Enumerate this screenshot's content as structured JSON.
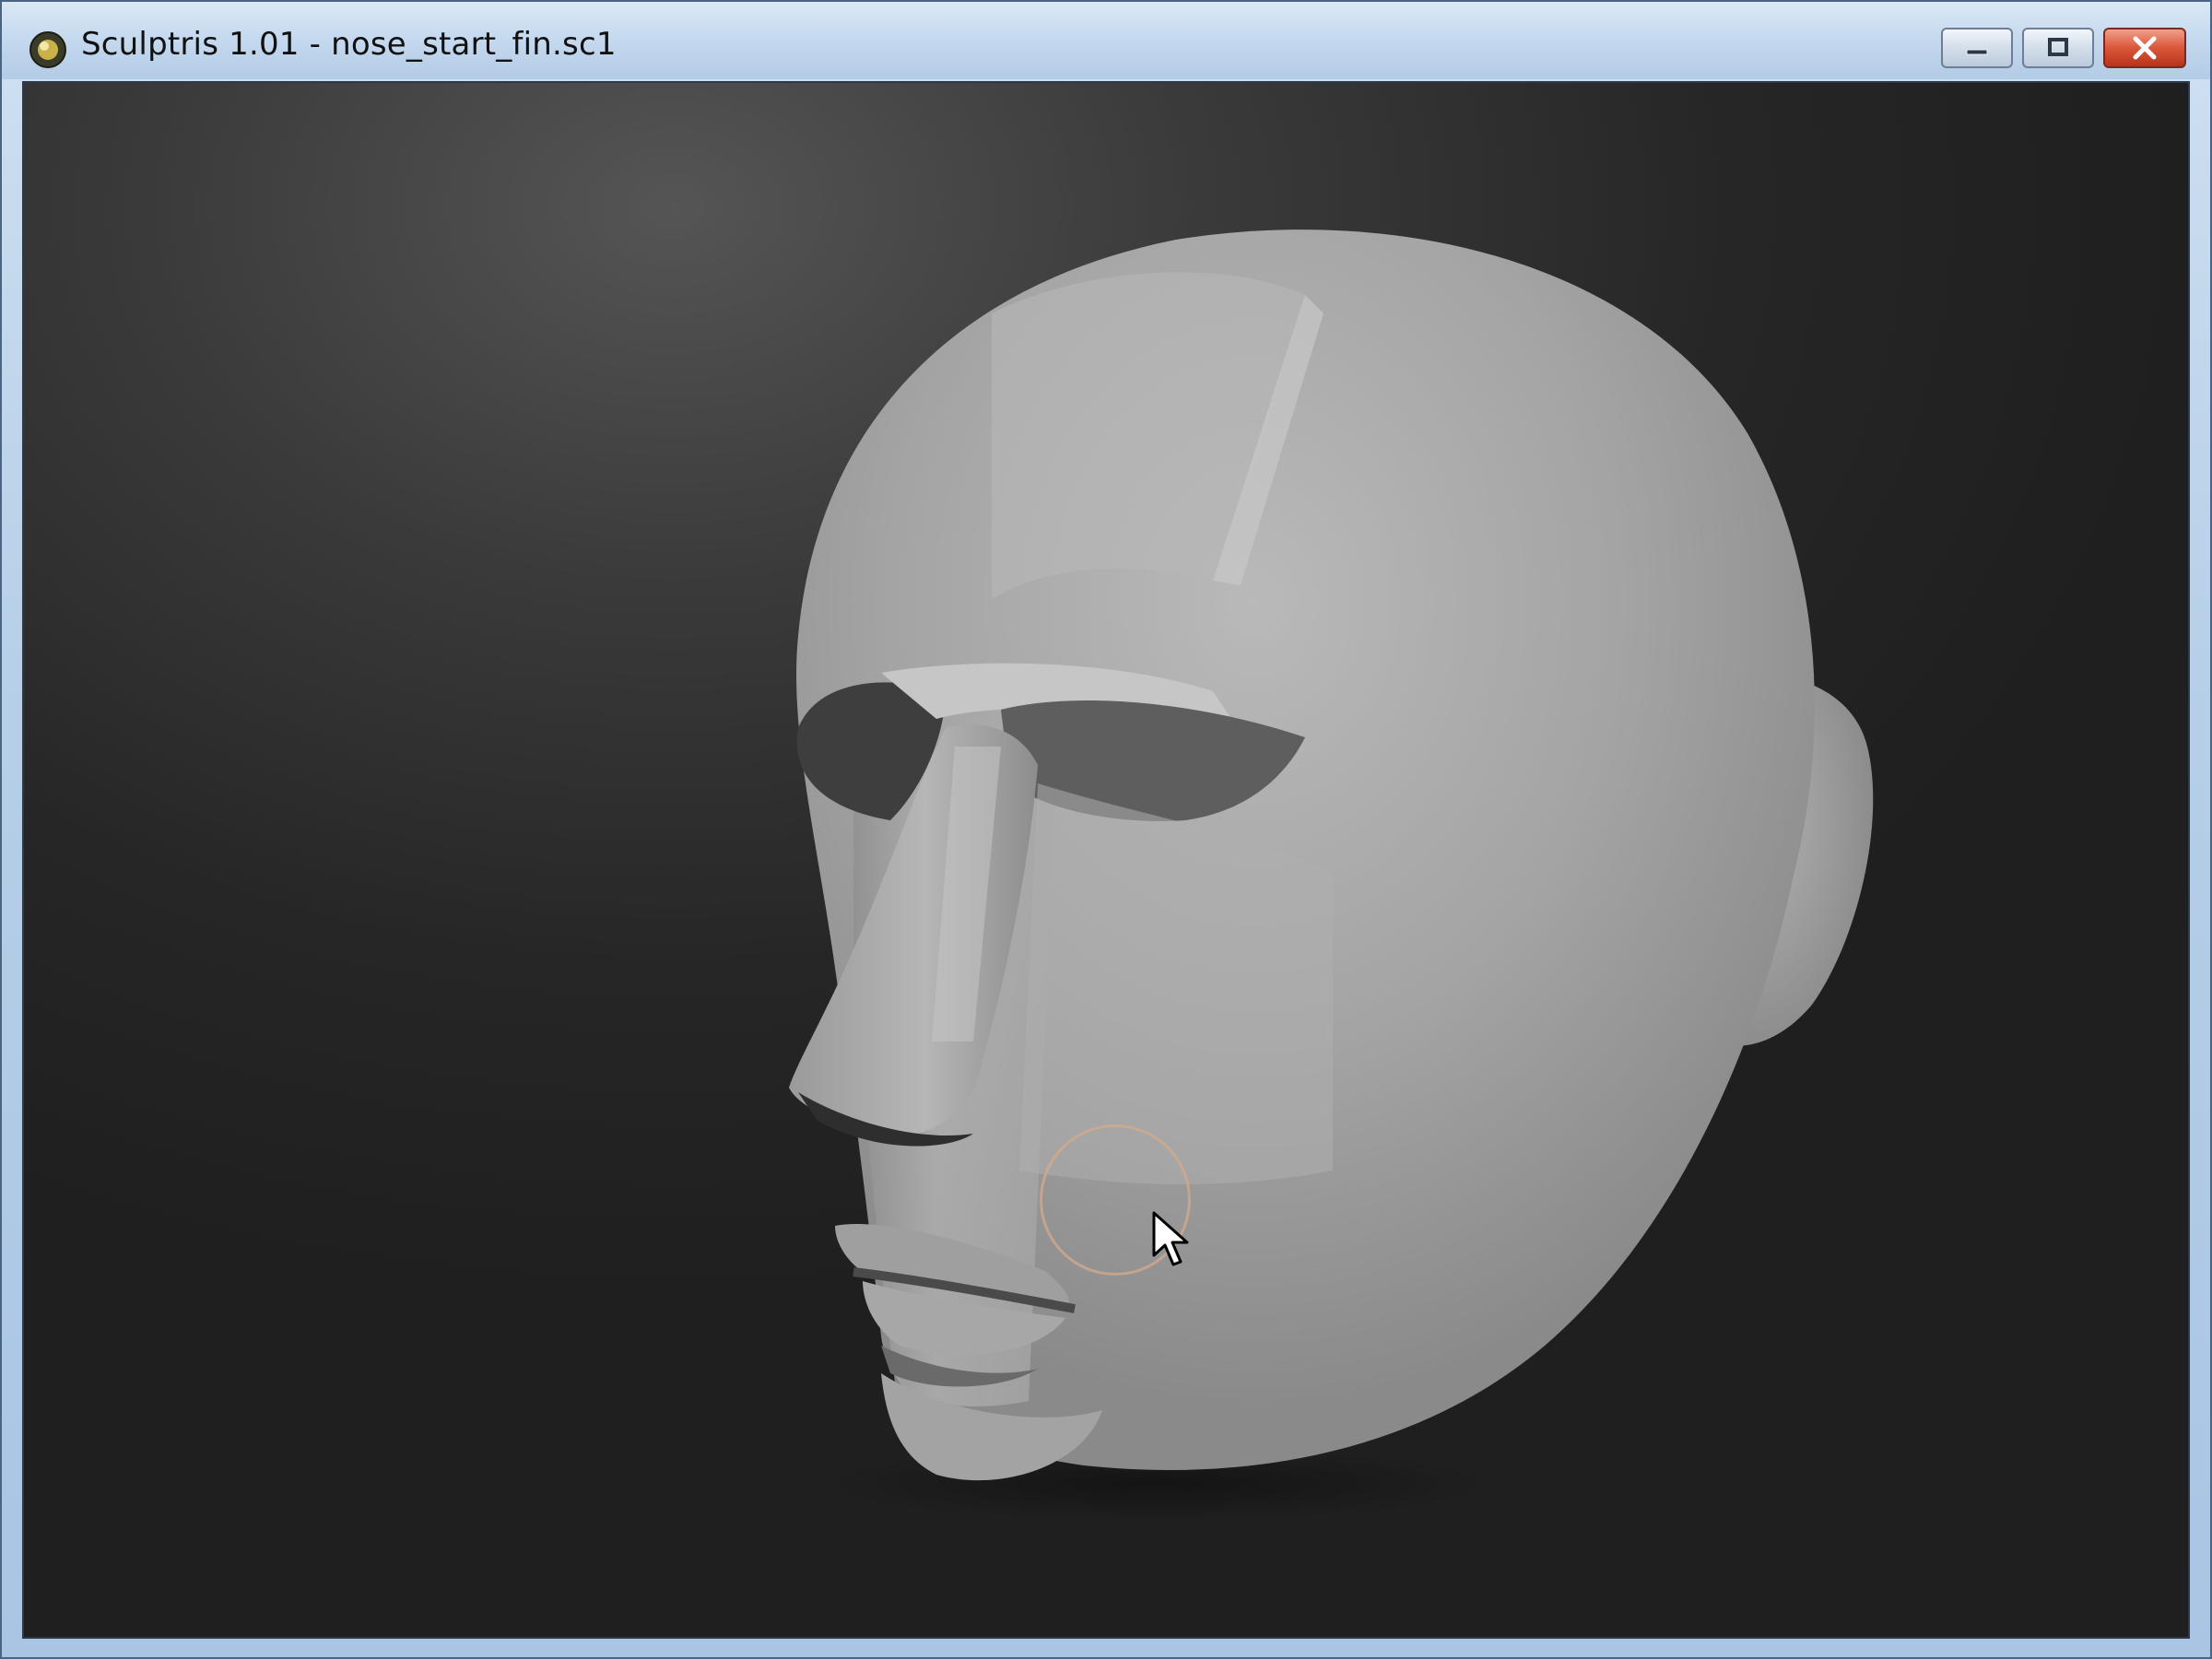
{
  "window": {
    "title": "Sculptris 1.01 - nose_start_fin.sc1",
    "controls": {
      "minimize_icon": "minimize-icon",
      "maximize_icon": "restore-icon",
      "close_icon": "close-icon"
    }
  },
  "viewport": {
    "model": "head-sculpt",
    "brush": "circle-brush-cursor",
    "pointer": "arrow-cursor-icon"
  },
  "colors": {
    "viewport_bg": "#262626",
    "model_base": "#a8a8a8",
    "brush_ring": "#d6aa8c",
    "close_button": "#d9573a"
  }
}
